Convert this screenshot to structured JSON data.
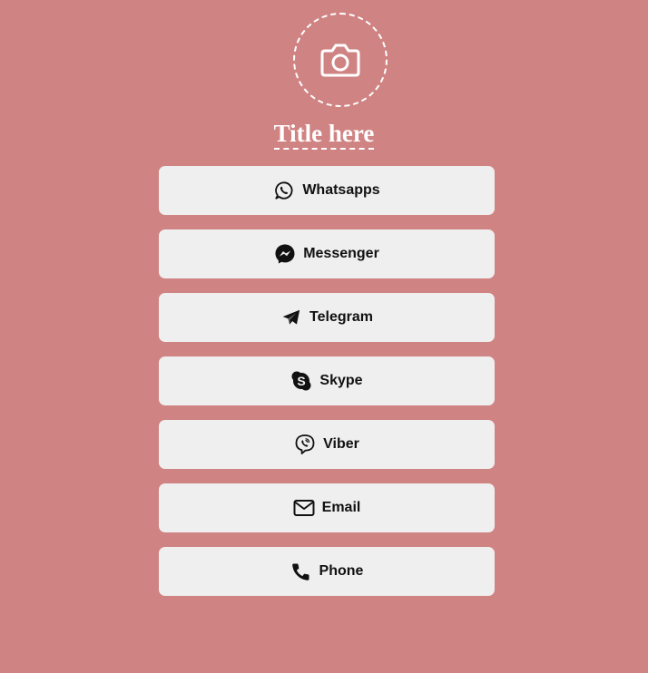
{
  "colors": {
    "background": "#d08383",
    "button_bg": "#efefef",
    "text": "#111111",
    "accent": "#ffffff"
  },
  "header": {
    "avatar_icon": "camera-icon",
    "title": "Title here"
  },
  "links": [
    {
      "label": "Whatsapps",
      "icon": "whatsapp-icon"
    },
    {
      "label": "Messenger",
      "icon": "messenger-icon"
    },
    {
      "label": "Telegram",
      "icon": "telegram-icon"
    },
    {
      "label": "Skype",
      "icon": "skype-icon"
    },
    {
      "label": "Viber",
      "icon": "viber-icon"
    },
    {
      "label": "Email",
      "icon": "email-icon"
    },
    {
      "label": "Phone",
      "icon": "phone-icon"
    }
  ]
}
